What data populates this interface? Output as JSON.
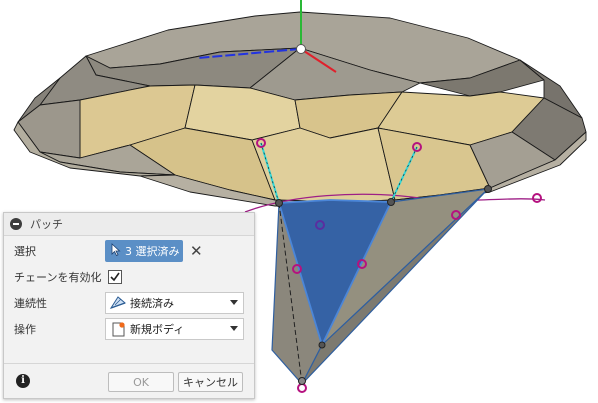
{
  "colors": {
    "surface_light": "#e3d4a1",
    "surface_tan": "#d9c690",
    "surface_gray": "#a8a397",
    "surface_dark": "#86827a",
    "patch_blue": "#3562a5",
    "curve_purple": "#9e1f86",
    "point_marker": "#b5127f",
    "axis_red": "#e0202b",
    "axis_green": "#2ab836",
    "axis_blue": "#2233e0",
    "tangent_cyan": "#34d6d6"
  },
  "panel": {
    "title": "パッチ",
    "rows": {
      "selection": {
        "label": "選択",
        "value": "3 選択済み",
        "clear_icon": "close-icon"
      },
      "chain": {
        "label": "チェーンを有効化",
        "checked": true
      },
      "continuity": {
        "label": "連続性",
        "value": "接続済み"
      },
      "operation": {
        "label": "操作",
        "value": "新規ボディ"
      }
    },
    "ok_label": "OK",
    "cancel_label": "キャンセル",
    "info_icon": "i"
  }
}
